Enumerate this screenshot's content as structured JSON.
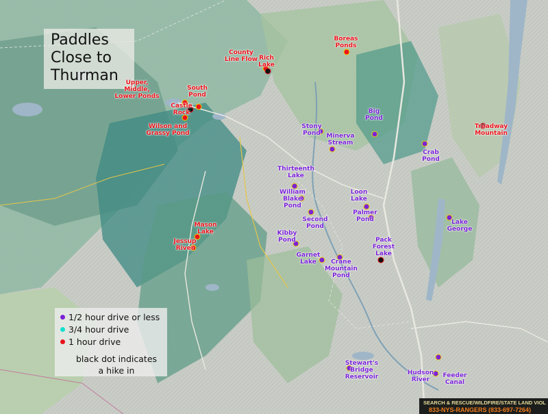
{
  "title": {
    "lines": [
      "Paddles",
      "Close to",
      "Thurman"
    ]
  },
  "colors": {
    "half_hour": "#7a22d6",
    "three_quarter_hour": "#13e0cf",
    "one_hour": "#e8141b",
    "dot_border": "#f2d100"
  },
  "legend": {
    "items": [
      {
        "label": "1/2 hour drive or less",
        "color": "#7a22d6"
      },
      {
        "label": "3/4 hour drive",
        "color": "#13e0cf"
      },
      {
        "label": "1 hour drive",
        "color": "#e8141b"
      }
    ],
    "note_lines": [
      "black dot indicates",
      "a hike in"
    ]
  },
  "paddles": [
    {
      "label": "County\nLine Flow",
      "category": "one_hour",
      "hike": false
    },
    {
      "label": "Rich\nLake",
      "category": "one_hour",
      "hike": true
    },
    {
      "label": "Boreas\nPonds",
      "category": "one_hour",
      "hike": false
    },
    {
      "label": "Upper,\nMiddle,\nLower Ponds",
      "category": "one_hour",
      "hike": false
    },
    {
      "label": "South\nPond",
      "category": "one_hour",
      "hike": false
    },
    {
      "label": "Castle\nRock",
      "category": "one_hour",
      "hike": true
    },
    {
      "label": "Wilson and\nGrassy Pond",
      "category": "one_hour",
      "hike": false
    },
    {
      "label": "Mason\nLake",
      "category": "one_hour",
      "hike": false
    },
    {
      "label": "Jessup\nRiver",
      "category": "one_hour",
      "hike": false
    },
    {
      "label": "Treadway\nMountain",
      "category": "one_hour",
      "hike": true
    },
    {
      "label": "Big\nPond",
      "category": "half_hour",
      "hike": false
    },
    {
      "label": "Stony\nPond",
      "category": "half_hour",
      "hike": false
    },
    {
      "label": "Minerva\nStream",
      "category": "half_hour",
      "hike": false
    },
    {
      "label": "Thirteenth\nLake",
      "category": "half_hour",
      "hike": false
    },
    {
      "label": "William\nBlake\nPond",
      "category": "half_hour",
      "hike": false
    },
    {
      "label": "Crab\nPond",
      "category": "half_hour",
      "hike": false
    },
    {
      "label": "Loon\nLake",
      "category": "half_hour",
      "hike": false
    },
    {
      "label": "Palmer\nPond",
      "category": "half_hour",
      "hike": false
    },
    {
      "label": "Second\nPond",
      "category": "half_hour",
      "hike": false
    },
    {
      "label": "Kibby\nPond",
      "category": "half_hour",
      "hike": false
    },
    {
      "label": "Garnet\nLake",
      "category": "half_hour",
      "hike": false
    },
    {
      "label": "Crane\nMountain\nPond",
      "category": "half_hour",
      "hike": false
    },
    {
      "label": "Pack\nForest\nLake",
      "category": "half_hour",
      "hike": true
    },
    {
      "label": "Lake\nGeorge",
      "category": "half_hour",
      "hike": false
    },
    {
      "label": "Stewart's\nBridge\nReservoir",
      "category": "half_hour",
      "hike": false
    },
    {
      "label": "Hudson\nRiver",
      "category": "half_hour",
      "hike": false
    },
    {
      "label": "Feeder\nCanal",
      "category": "half_hour",
      "hike": false
    }
  ],
  "footer": {
    "line1": "SEARCH & RESCUE/WILDFIRE/STATE LAND VIOL",
    "line2": "833-NYS-RANGERS (833-697-7264)"
  }
}
